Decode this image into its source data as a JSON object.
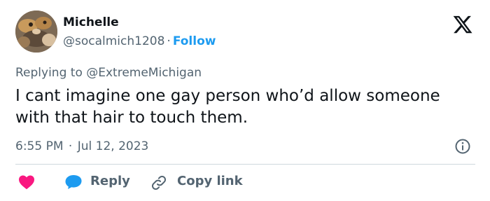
{
  "author": {
    "name": "Michelle",
    "handle": "@socalmich1208",
    "separator": "·",
    "follow_label": "Follow",
    "avatar": "avatar-photo"
  },
  "brand": {
    "logo_icon": "x-logo-icon"
  },
  "reply_context": {
    "prefix": "Replying to",
    "mention": "@ExtremeMichigan"
  },
  "tweet": {
    "text": "I cant imagine one gay person who’d allow someone with that hair to touch them."
  },
  "meta": {
    "time": "6:55 PM",
    "separator": "·",
    "date": "Jul 12, 2023",
    "info_icon": "info-icon"
  },
  "actions": {
    "like_icon": "heart-icon",
    "reply_icon": "speech-bubble-icon",
    "reply_label": "Reply",
    "copy_icon": "link-icon",
    "copy_label": "Copy link"
  },
  "colors": {
    "text_primary": "#0f1419",
    "text_secondary": "#536471",
    "accent_blue": "#1d9bf0",
    "heart_red": "#f91880",
    "divider": "#cfd9de"
  }
}
